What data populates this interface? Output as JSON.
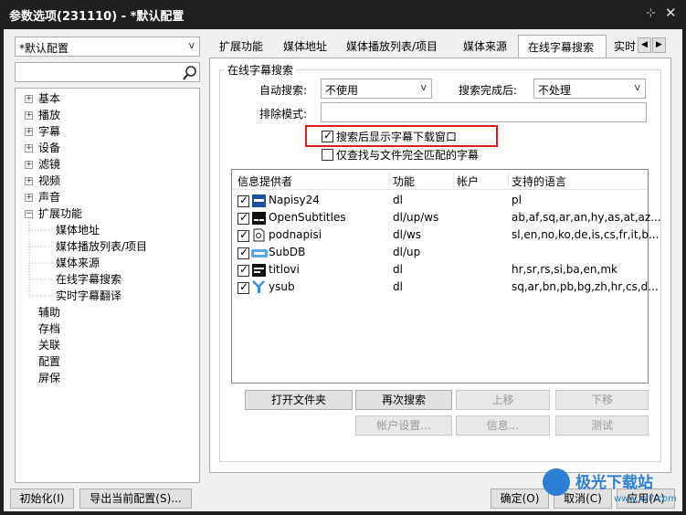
{
  "window": {
    "title": "参数选项(231110) - *默认配置"
  },
  "profile_select": {
    "value": "*默认配置"
  },
  "search_input": {
    "value": ""
  },
  "tree": {
    "items": [
      "基本",
      "播放",
      "字幕",
      "设备",
      "滤镜",
      "视频",
      "声音",
      "扩展功能"
    ],
    "ext_children": [
      "媒体地址",
      "媒体播放列表/项目",
      "媒体来源",
      "在线字幕搜索",
      "实时字幕翻译"
    ],
    "tail_items": [
      "辅助",
      "存档",
      "关联",
      "配置",
      "屏保"
    ]
  },
  "tabs": [
    "扩展功能",
    "媒体地址",
    "媒体播放列表/项目",
    "媒体来源",
    "在线字幕搜索",
    "实时"
  ],
  "group": {
    "title": "在线字幕搜索",
    "auto_search_label": "自动搜索:",
    "auto_search_value": "不使用",
    "after_search_label": "搜索完成后:",
    "after_search_value": "不处理",
    "exclude_label": "排除模式:",
    "exclude_value": "",
    "chk_show_window": "搜索后显示字幕下载窗口",
    "chk_exact_match": "仅查找与文件完全匹配的字幕"
  },
  "providers": {
    "headers": [
      "信息提供者",
      "功能",
      "帐户",
      "支持的语言"
    ],
    "rows": [
      {
        "name": "Napisy24",
        "func": "dl",
        "account": "",
        "langs": "pl",
        "icon": "napisy-icon"
      },
      {
        "name": "OpenSubtitles",
        "func": "dl/up/ws",
        "account": "",
        "langs": "ab,af,sq,ar,an,hy,as,at,az...",
        "icon": "opensubtitles-icon"
      },
      {
        "name": "podnapisi",
        "func": "dl/ws",
        "account": "",
        "langs": "sl,en,no,ko,de,is,cs,fr,it,b...",
        "icon": "podnapisi-icon"
      },
      {
        "name": "SubDB",
        "func": "dl/up",
        "account": "",
        "langs": "",
        "icon": "subdb-icon"
      },
      {
        "name": "titlovi",
        "func": "dl",
        "account": "",
        "langs": "hr,sr,rs,si,ba,en,mk",
        "icon": "titlovi-icon"
      },
      {
        "name": "ysub",
        "func": "dl",
        "account": "",
        "langs": "sq,ar,bn,pb,bg,zh,hr,cs,d...",
        "icon": "ysub-icon"
      }
    ]
  },
  "buttons": {
    "open_folder": "打开文件夹",
    "search_again": "再次搜索",
    "move_up": "上移",
    "move_down": "下移",
    "account_settings": "帐户设置...",
    "info": "信息...",
    "test": "测试",
    "init": "初始化(I)",
    "export": "导出当前配置(S)...",
    "ok": "确定(O)",
    "cancel": "取消(C)",
    "apply": "应用(A)"
  },
  "watermark": {
    "text": "极光下载站",
    "url": "www.xz7.com"
  }
}
